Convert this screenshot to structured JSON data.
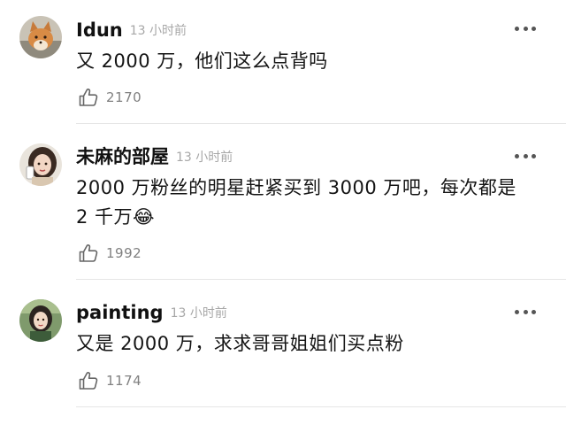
{
  "comments": [
    {
      "username": "Idun",
      "time": "13 小时前",
      "text": "又 2000 万，他们这么点背吗",
      "likes": "2170",
      "avatar_icon": "fox-avatar-icon"
    },
    {
      "username": "未麻的部屋",
      "time": "13 小时前",
      "text": "2000 万粉丝的明星赶紧买到 3000 万吧，每次都是 2 千万😂",
      "likes": "1992",
      "avatar_icon": "girl-avatar-icon"
    },
    {
      "username": "painting",
      "time": "13 小时前",
      "text": "又是 2000 万，求求哥哥姐姐们买点粉",
      "likes": "1174",
      "avatar_icon": "girl-painting-avatar-icon"
    }
  ],
  "colors": {
    "time": "#a7a7a7",
    "divider": "#e6e6e6",
    "like_count": "#808080"
  }
}
